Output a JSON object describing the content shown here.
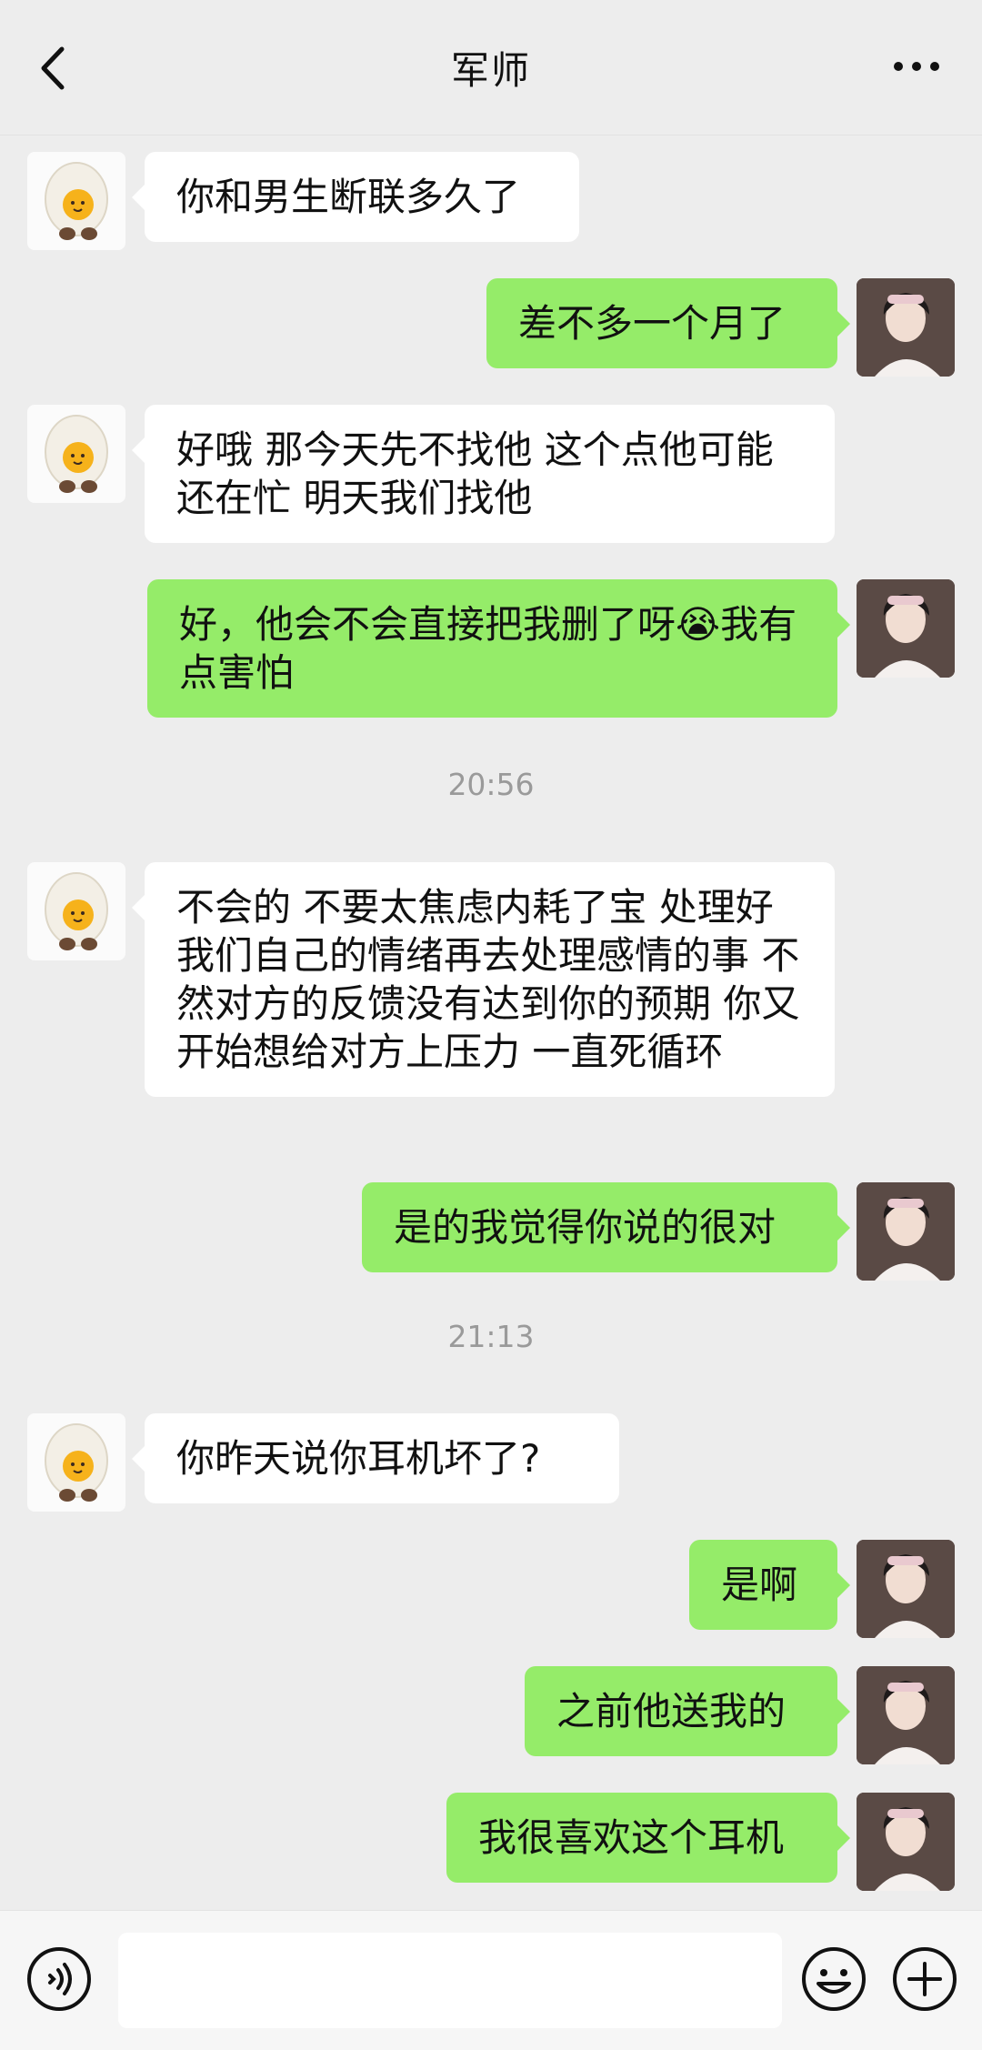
{
  "header": {
    "title": "军师",
    "back_icon": "chevron-left-icon",
    "more_icon": "more-horizontal-icon"
  },
  "messages": [
    {
      "side": "left",
      "text": "你和男生断联多久了"
    },
    {
      "side": "right",
      "text": "差不多一个月了"
    },
    {
      "side": "left",
      "text": "好哦 那今天先不找他 这个点他可能还在忙 明天我们找他"
    },
    {
      "side": "right",
      "text": "好，他会不会直接把我删了呀😭我有点害怕"
    },
    {
      "side": "left",
      "text": "不会的 不要太焦虑内耗了宝 处理好我们自己的情绪再去处理感情的事 不然对方的反馈没有达到你的预期 你又开始想给对方上压力 一直死循环"
    },
    {
      "side": "right",
      "text": "是的我觉得你说的很对"
    },
    {
      "side": "left",
      "text": "你昨天说你耳机坏了?"
    },
    {
      "side": "right",
      "text": "是啊"
    },
    {
      "side": "right",
      "text": "之前他送我的"
    },
    {
      "side": "right",
      "text": "我很喜欢这个耳机"
    }
  ],
  "timestamps": [
    "20:56",
    "21:13"
  ],
  "input_bar": {
    "value": "",
    "voice_icon": "voice-icon",
    "emoji_icon": "emoji-icon",
    "plus_icon": "plus-icon"
  },
  "colors": {
    "background": "#ededed",
    "sent_bubble": "#95ec69",
    "received_bubble": "#ffffff"
  }
}
